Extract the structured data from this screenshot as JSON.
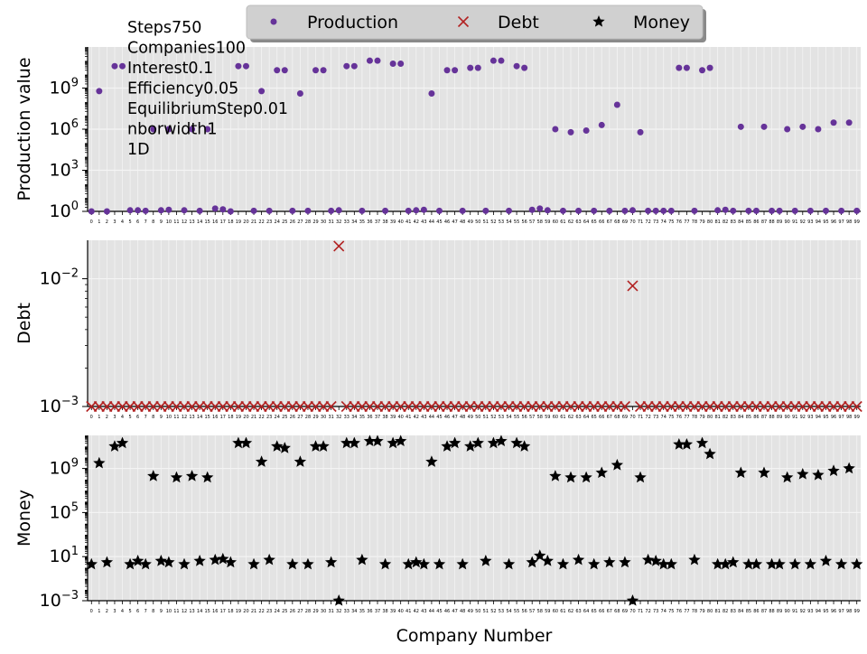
{
  "chart_data": [
    {
      "type": "scatter",
      "panel": "production",
      "ylabel": "Production value",
      "yscale": "log",
      "ylim": [
        1,
        1000000000000
      ],
      "yticks": [
        "10^0",
        "10^3",
        "10^6",
        "10^9"
      ],
      "xlim": [
        0,
        99
      ],
      "xticklabels_from": "0..99",
      "grid": true,
      "series": [
        {
          "name": "Production",
          "color": "#663399",
          "marker": "dot",
          "points": [
            [
              1,
              600000000
            ],
            [
              3,
              40000000000
            ],
            [
              4,
              40000000000
            ],
            [
              8,
              1000000
            ],
            [
              10,
              1000000
            ],
            [
              13,
              1000000
            ],
            [
              15,
              1000000
            ],
            [
              19,
              40000000000
            ],
            [
              20,
              40000000000
            ],
            [
              22,
              600000000
            ],
            [
              24,
              20000000000
            ],
            [
              25,
              20000000000
            ],
            [
              27,
              400000000
            ],
            [
              29,
              20000000000
            ],
            [
              30,
              20000000000
            ],
            [
              33,
              40000000000
            ],
            [
              34,
              40000000000
            ],
            [
              36,
              100000000000
            ],
            [
              37,
              100000000000
            ],
            [
              39,
              60000000000
            ],
            [
              40,
              60000000000
            ],
            [
              44,
              400000000
            ],
            [
              46,
              20000000000
            ],
            [
              47,
              20000000000
            ],
            [
              49,
              30000000000
            ],
            [
              50,
              30000000000
            ],
            [
              52,
              100000000000
            ],
            [
              53,
              100000000000
            ],
            [
              55,
              40000000000
            ],
            [
              56,
              30000000000
            ],
            [
              60,
              1000000
            ],
            [
              62,
              600000
            ],
            [
              64,
              800000
            ],
            [
              66,
              2000000
            ],
            [
              68,
              60000000
            ],
            [
              71,
              600000
            ],
            [
              76,
              30000000000
            ],
            [
              77,
              30000000000
            ],
            [
              79,
              20000000000
            ],
            [
              80,
              30000000000
            ],
            [
              84,
              1500000
            ],
            [
              87,
              1500000
            ],
            [
              90,
              1000000
            ],
            [
              92,
              1500000
            ],
            [
              94,
              1000000
            ],
            [
              96,
              3000000
            ],
            [
              98,
              3000000
            ],
            [
              0,
              1
            ],
            [
              2,
              1
            ],
            [
              5,
              1.2
            ],
            [
              6,
              1.2
            ],
            [
              7,
              1.1
            ],
            [
              9,
              1.2
            ],
            [
              10,
              1.3
            ],
            [
              12,
              1.2
            ],
            [
              14,
              1.1
            ],
            [
              16,
              1.6
            ],
            [
              17,
              1.4
            ],
            [
              18,
              1
            ],
            [
              21,
              1.1
            ],
            [
              23,
              1.1
            ],
            [
              26,
              1.1
            ],
            [
              28,
              1.1
            ],
            [
              31,
              1.1
            ],
            [
              32,
              1.2
            ],
            [
              35,
              1.1
            ],
            [
              38,
              1.1
            ],
            [
              41,
              1.1
            ],
            [
              42,
              1.2
            ],
            [
              43,
              1.3
            ],
            [
              45,
              1.1
            ],
            [
              48,
              1.1
            ],
            [
              51,
              1.1
            ],
            [
              54,
              1.1
            ],
            [
              57,
              1.3
            ],
            [
              58,
              1.6
            ],
            [
              59,
              1.2
            ],
            [
              61,
              1.1
            ],
            [
              63,
              1.1
            ],
            [
              65,
              1.1
            ],
            [
              67,
              1.1
            ],
            [
              69,
              1.1
            ],
            [
              70,
              1.2
            ],
            [
              72,
              1.1
            ],
            [
              73,
              1.1
            ],
            [
              74,
              1.1
            ],
            [
              75,
              1.1
            ],
            [
              78,
              1.1
            ],
            [
              81,
              1.2
            ],
            [
              82,
              1.3
            ],
            [
              83,
              1.1
            ],
            [
              85,
              1.1
            ],
            [
              86,
              1.1
            ],
            [
              88,
              1.1
            ],
            [
              89,
              1.1
            ],
            [
              91,
              1.1
            ],
            [
              93,
              1.1
            ],
            [
              95,
              1.1
            ],
            [
              97,
              1.1
            ],
            [
              99,
              1.1
            ]
          ]
        }
      ],
      "annotation_lines": [
        "Steps750",
        "Companies100",
        "Interest0.1",
        "Efficiency0.05",
        "EquilibriumStep0.01",
        "nborwidth1",
        "1D"
      ]
    },
    {
      "type": "scatter",
      "panel": "debt",
      "ylabel": "Debt",
      "yscale": "log",
      "ylim": [
        0.001,
        0.02
      ],
      "yticks": [
        "10^-3",
        "10^-2"
      ],
      "xlim": [
        0,
        99
      ],
      "grid": true,
      "series": [
        {
          "name": "Debt",
          "color": "#b22222",
          "marker": "x",
          "baseline": 0.001,
          "excluded": [
            32,
            70
          ],
          "points": [
            [
              32,
              0.018
            ],
            [
              70,
              0.0088
            ]
          ]
        }
      ]
    },
    {
      "type": "scatter",
      "panel": "money",
      "ylabel": "Money",
      "xlabel": "Company Number",
      "yscale": "log",
      "ylim": [
        0.001,
        1000000000000
      ],
      "yticks": [
        "10^-3",
        "10^1",
        "10^5",
        "10^9"
      ],
      "xlim": [
        0,
        99
      ],
      "grid": true,
      "series": [
        {
          "name": "Money",
          "color": "#000000",
          "marker": "star",
          "points": [
            [
              0,
              2
            ],
            [
              1,
              3000000000
            ],
            [
              2,
              3
            ],
            [
              3,
              100000000000
            ],
            [
              4,
              200000000000
            ],
            [
              5,
              2
            ],
            [
              6,
              4
            ],
            [
              7,
              2
            ],
            [
              8,
              200000000
            ],
            [
              9,
              4
            ],
            [
              10,
              3
            ],
            [
              11,
              150000000
            ],
            [
              12,
              2
            ],
            [
              13,
              200000000
            ],
            [
              14,
              4
            ],
            [
              15,
              150000000
            ],
            [
              16,
              5
            ],
            [
              17,
              6
            ],
            [
              18,
              3
            ],
            [
              19,
              200000000000
            ],
            [
              20,
              200000000000
            ],
            [
              21,
              2
            ],
            [
              22,
              4000000000
            ],
            [
              23,
              5
            ],
            [
              24,
              100000000000
            ],
            [
              25,
              70000000000
            ],
            [
              26,
              2
            ],
            [
              27,
              4000000000
            ],
            [
              28,
              2
            ],
            [
              29,
              100000000000
            ],
            [
              30,
              100000000000
            ],
            [
              31,
              3
            ],
            [
              32,
              0.001
            ],
            [
              33,
              200000000000
            ],
            [
              34,
              200000000000
            ],
            [
              35,
              5
            ],
            [
              36,
              300000000000
            ],
            [
              37,
              300000000000
            ],
            [
              38,
              2
            ],
            [
              39,
              200000000000
            ],
            [
              40,
              300000000000
            ],
            [
              41,
              2
            ],
            [
              42,
              3
            ],
            [
              43,
              2
            ],
            [
              44,
              4000000000
            ],
            [
              45,
              2
            ],
            [
              46,
              100000000000
            ],
            [
              47,
              200000000000
            ],
            [
              48,
              2
            ],
            [
              49,
              100000000000
            ],
            [
              50,
              200000000000
            ],
            [
              51,
              4
            ],
            [
              52,
              200000000000
            ],
            [
              53,
              300000000000
            ],
            [
              54,
              2
            ],
            [
              55,
              200000000000
            ],
            [
              56,
              100000000000
            ],
            [
              57,
              3
            ],
            [
              58,
              12
            ],
            [
              59,
              4
            ],
            [
              60,
              200000000
            ],
            [
              61,
              2
            ],
            [
              62,
              150000000
            ],
            [
              63,
              5
            ],
            [
              64,
              150000000
            ],
            [
              65,
              2
            ],
            [
              66,
              400000000
            ],
            [
              67,
              3
            ],
            [
              68,
              2000000000
            ],
            [
              69,
              3
            ],
            [
              70,
              0.001
            ],
            [
              71,
              150000000
            ],
            [
              72,
              5
            ],
            [
              73,
              4
            ],
            [
              74,
              2
            ],
            [
              75,
              2
            ],
            [
              76,
              150000000000
            ],
            [
              77,
              150000000000
            ],
            [
              78,
              5
            ],
            [
              79,
              200000000000
            ],
            [
              80,
              20000000000
            ],
            [
              81,
              2
            ],
            [
              82,
              2
            ],
            [
              83,
              3
            ],
            [
              84,
              400000000
            ],
            [
              85,
              2
            ],
            [
              86,
              2
            ],
            [
              87,
              400000000
            ],
            [
              88,
              2
            ],
            [
              89,
              2
            ],
            [
              90,
              150000000
            ],
            [
              91,
              2
            ],
            [
              92,
              300000000
            ],
            [
              93,
              2
            ],
            [
              94,
              250000000
            ],
            [
              95,
              4
            ],
            [
              96,
              600000000
            ],
            [
              97,
              2
            ],
            [
              98,
              1000000000
            ],
            [
              99,
              2
            ]
          ]
        }
      ]
    }
  ],
  "legend": {
    "placement": "top-center",
    "items": [
      {
        "label": "Production",
        "marker": "dot",
        "color": "#663399"
      },
      {
        "label": "Debt",
        "marker": "x",
        "color": "#b22222"
      },
      {
        "label": "Money",
        "marker": "star",
        "color": "#000000"
      }
    ]
  }
}
